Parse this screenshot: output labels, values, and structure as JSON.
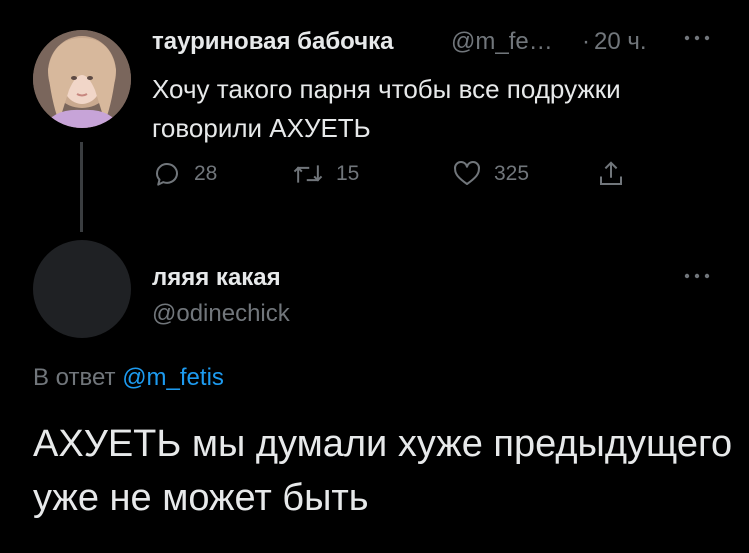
{
  "tweet": {
    "author_name": "тауриновая бабочка",
    "author_handle": "@m_fe…",
    "separator": "·",
    "time": "20 ч.",
    "text": "Хочу такого парня чтобы все подружки говорили АХУЕТЬ",
    "replies": "28",
    "retweets": "15",
    "likes": "325"
  },
  "reply": {
    "author_name": "ляяя какая",
    "author_handle": "@odinechick",
    "reply_prefix": "В ответ",
    "reply_mention": "@m_fetis",
    "text": "АХУЕТЬ мы думали хуже предыдущего уже не может быть"
  },
  "icons": {
    "reply": "speech-bubble-icon",
    "retweet": "retweet-icon",
    "like": "heart-icon",
    "share": "share-icon",
    "more": "more-dots-icon"
  },
  "colors": {
    "background": "#000000",
    "text": "#e7e9ea",
    "muted": "#71767b",
    "link": "#1d9bf0"
  }
}
